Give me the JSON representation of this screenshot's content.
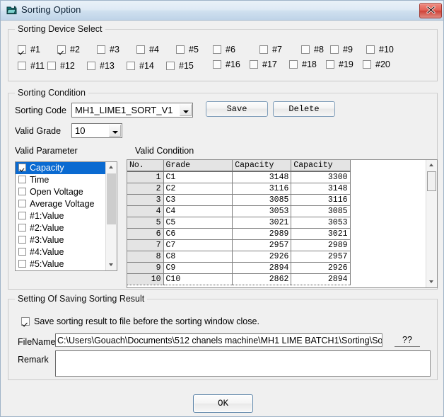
{
  "window": {
    "title": "Sorting Option",
    "icon": "sorting-window-icon",
    "close_label": "x",
    "accent": "#0a6ad1",
    "titlebar_color": "#bfd4e8",
    "close_color": "#cf4036"
  },
  "device_group": {
    "legend": "Sorting Device Select",
    "devices": [
      {
        "label": "#1",
        "checked": true
      },
      {
        "label": "#2",
        "checked": true
      },
      {
        "label": "#3",
        "checked": false
      },
      {
        "label": "#4",
        "checked": false
      },
      {
        "label": "#5",
        "checked": false
      },
      {
        "label": "#6",
        "checked": false
      },
      {
        "label": "#7",
        "checked": false
      },
      {
        "label": "#8",
        "checked": false
      },
      {
        "label": "#9",
        "checked": false
      },
      {
        "label": "#10",
        "checked": false
      },
      {
        "label": "#11",
        "checked": false
      },
      {
        "label": "#12",
        "checked": false
      },
      {
        "label": "#13",
        "checked": false
      },
      {
        "label": "#14",
        "checked": false
      },
      {
        "label": "#15",
        "checked": false
      },
      {
        "label": "#16",
        "checked": false
      },
      {
        "label": "#17",
        "checked": false
      },
      {
        "label": "#18",
        "checked": false
      },
      {
        "label": "#19",
        "checked": false
      },
      {
        "label": "#20",
        "checked": false
      }
    ]
  },
  "condition_group": {
    "legend": "Sorting Condition",
    "sorting_code_label": "Sorting Code",
    "sorting_code_value": "MH1_LIME1_SORT_V1",
    "valid_grade_label": "Valid Grade",
    "valid_grade_value": "10",
    "save_button": "Save",
    "delete_button": "Delete",
    "valid_parameter_label": "Valid Parameter",
    "valid_condition_label": "Valid Condition",
    "parameters": [
      {
        "label": "Capacity",
        "checked": true,
        "selected": true
      },
      {
        "label": "Time",
        "checked": false,
        "selected": false
      },
      {
        "label": "Open Voltage",
        "checked": false,
        "selected": false
      },
      {
        "label": "Average Voltage",
        "checked": false,
        "selected": false
      },
      {
        "label": "#1:Value",
        "checked": false,
        "selected": false
      },
      {
        "label": "#2:Value",
        "checked": false,
        "selected": false
      },
      {
        "label": "#3:Value",
        "checked": false,
        "selected": false
      },
      {
        "label": "#4:Value",
        "checked": false,
        "selected": false
      },
      {
        "label": "#5:Value",
        "checked": false,
        "selected": false
      }
    ],
    "grid": {
      "columns": [
        "No.",
        "Grade",
        "Capacity",
        "Capacity"
      ],
      "rows": [
        [
          "1",
          "C1",
          "3148",
          "3300"
        ],
        [
          "2",
          "C2",
          "3116",
          "3148"
        ],
        [
          "3",
          "C3",
          "3085",
          "3116"
        ],
        [
          "4",
          "C4",
          "3053",
          "3085"
        ],
        [
          "5",
          "C5",
          "3021",
          "3053"
        ],
        [
          "6",
          "C6",
          "2989",
          "3021"
        ],
        [
          "7",
          "C7",
          "2957",
          "2989"
        ],
        [
          "8",
          "C8",
          "2926",
          "2957"
        ],
        [
          "9",
          "C9",
          "2894",
          "2926"
        ],
        [
          "10",
          "C10",
          "2862",
          "2894"
        ]
      ]
    }
  },
  "save_group": {
    "legend": "Setting Of Saving Sorting Result",
    "save_checkbox_label": "Save sorting result to file before the sorting window close.",
    "save_checkbox_checked": true,
    "filename_label": "FileName",
    "filename_value": "C:\\Users\\Gouach\\Documents\\512 chanels machine\\MH1 LIME BATCH1\\Sorting\\Sortin",
    "browse_button": "??",
    "remark_label": "Remark",
    "remark_value": ""
  },
  "footer": {
    "ok_button": "OK"
  }
}
